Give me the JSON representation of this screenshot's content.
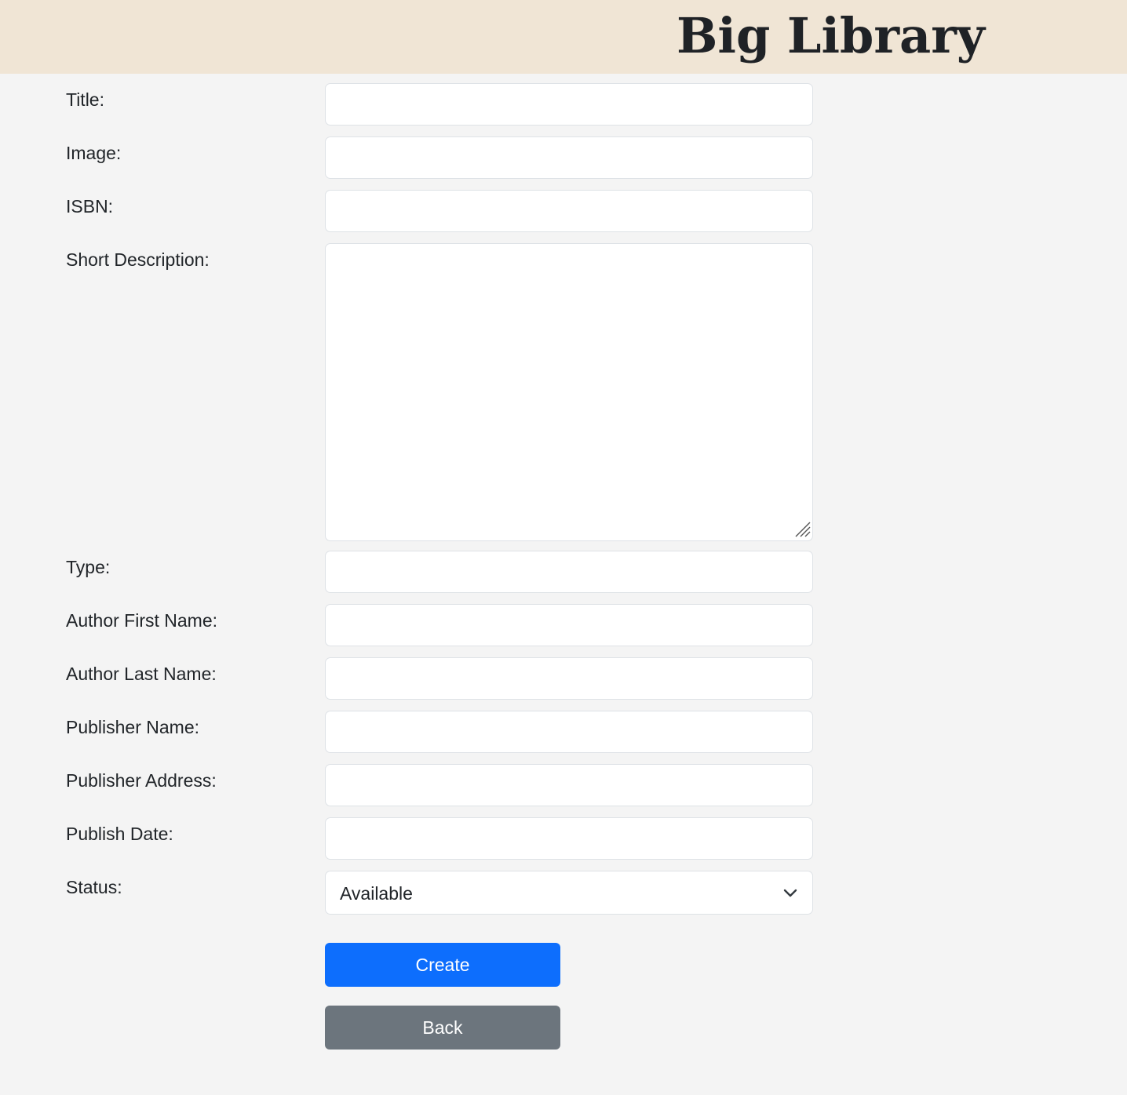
{
  "header": {
    "brand": "Big Library",
    "background_color": "#f0e5d5"
  },
  "form": {
    "fields": {
      "title": {
        "label": "Title:",
        "value": ""
      },
      "image": {
        "label": "Image:",
        "value": ""
      },
      "isbn": {
        "label": "ISBN:",
        "value": ""
      },
      "short_description": {
        "label": "Short Description:",
        "value": ""
      },
      "type": {
        "label": "Type:",
        "value": ""
      },
      "author_first_name": {
        "label": "Author First Name:",
        "value": ""
      },
      "author_last_name": {
        "label": "Author Last Name:",
        "value": ""
      },
      "publisher_name": {
        "label": "Publisher Name:",
        "value": ""
      },
      "publisher_address": {
        "label": "Publisher Address:",
        "value": ""
      },
      "publish_date": {
        "label": "Publish Date:",
        "value": ""
      },
      "status": {
        "label": "Status:",
        "selected": "Available",
        "icon": "chevron-down-icon"
      }
    },
    "buttons": {
      "create": {
        "label": "Create",
        "color": "#0d6efd"
      },
      "back": {
        "label": "Back",
        "color": "#6c757d"
      }
    }
  }
}
